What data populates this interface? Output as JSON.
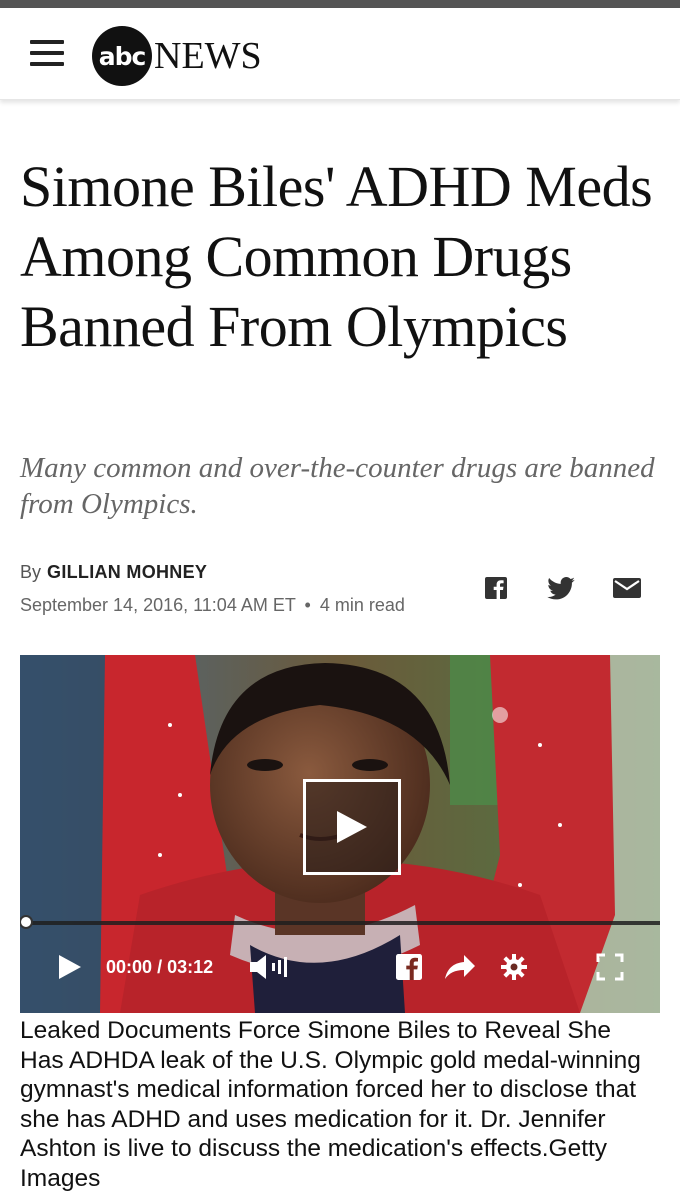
{
  "header": {
    "menu_icon": "hamburger-menu-icon",
    "logo_abc": "abc",
    "logo_news": "NEWS"
  },
  "article": {
    "headline": "Simone Biles' ADHD Meds Among Common Drugs Banned From Olympics",
    "subheadline": "Many common and over-the-counter drugs are banned from Olympics.",
    "by_label": "By",
    "author": "GILLIAN MOHNEY",
    "date": "September 14, 2016, 11:04 AM ET",
    "separator": "•",
    "read_time": "4 min read",
    "share_icons": [
      "facebook-icon",
      "twitter-icon",
      "mail-icon"
    ]
  },
  "video": {
    "time_current": "00:00",
    "time_separator": "/",
    "time_total": "03:12",
    "progress_fraction": 0,
    "control_icons": [
      "play-icon",
      "volume-icon",
      "facebook-icon",
      "share-arrow-icon",
      "gear-icon",
      "fullscreen-icon"
    ],
    "caption": "Leaked Documents Force Simone Biles to Reveal She Has ADHDA leak of the U.S. Olympic gold medal-winning gymnast's medical information forced her to disclose that she has ADHD and uses medication for it. Dr. Jennifer Ashton is live to discuss the medication's effects.Getty Images"
  },
  "colors": {
    "text": "#111111",
    "subhead": "#666666",
    "top_strip": "#555555",
    "jersey_red": "#c8262d"
  }
}
